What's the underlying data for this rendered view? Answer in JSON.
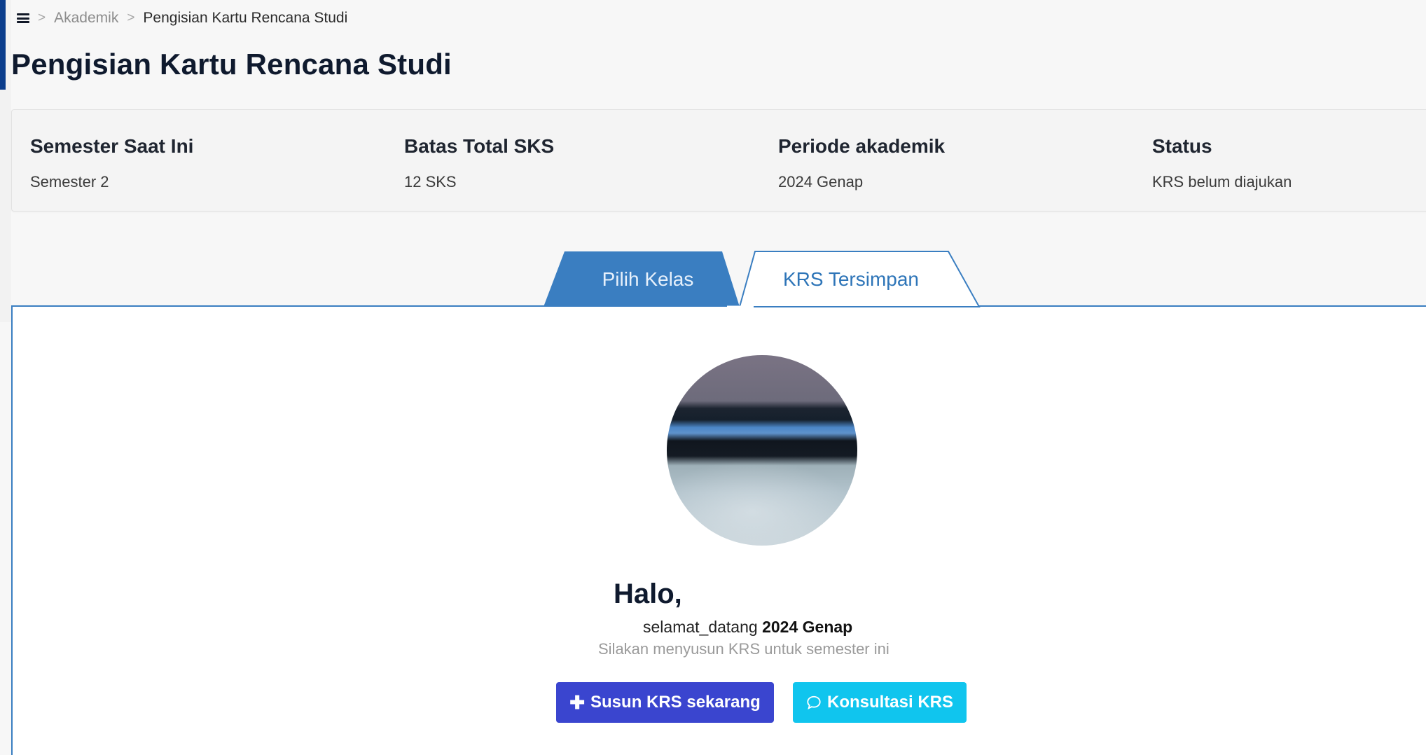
{
  "breadcrumb": {
    "items": [
      "Akademik",
      "Pengisian Kartu Rencana Studi"
    ],
    "separator": ">"
  },
  "page": {
    "title": "Pengisian Kartu Rencana Studi"
  },
  "info": {
    "semester": {
      "label": "Semester Saat Ini",
      "value": "Semester 2"
    },
    "sks": {
      "label": "Batas Total SKS",
      "value": "12 SKS"
    },
    "periode": {
      "label": "Periode akademik",
      "value": "2024 Genap"
    },
    "status": {
      "label": "Status",
      "value": "KRS belum diajukan"
    }
  },
  "tabs": {
    "pilih": "Pilih Kelas",
    "tersimpan": "KRS Tersimpan"
  },
  "welcome": {
    "greeting": "Halo,",
    "line_prefix": "selamat_datang",
    "line_period": "2024 Genap",
    "hint": "Silakan menyusun KRS untuk semester ini"
  },
  "actions": {
    "susun": "Susun KRS sekarang",
    "konsultasi": "Konsultasi KRS"
  },
  "colors": {
    "tab_active": "#3a7ec1",
    "primary": "#3a45cf",
    "info": "#10c5ee",
    "accent": "#0b3d8c"
  }
}
